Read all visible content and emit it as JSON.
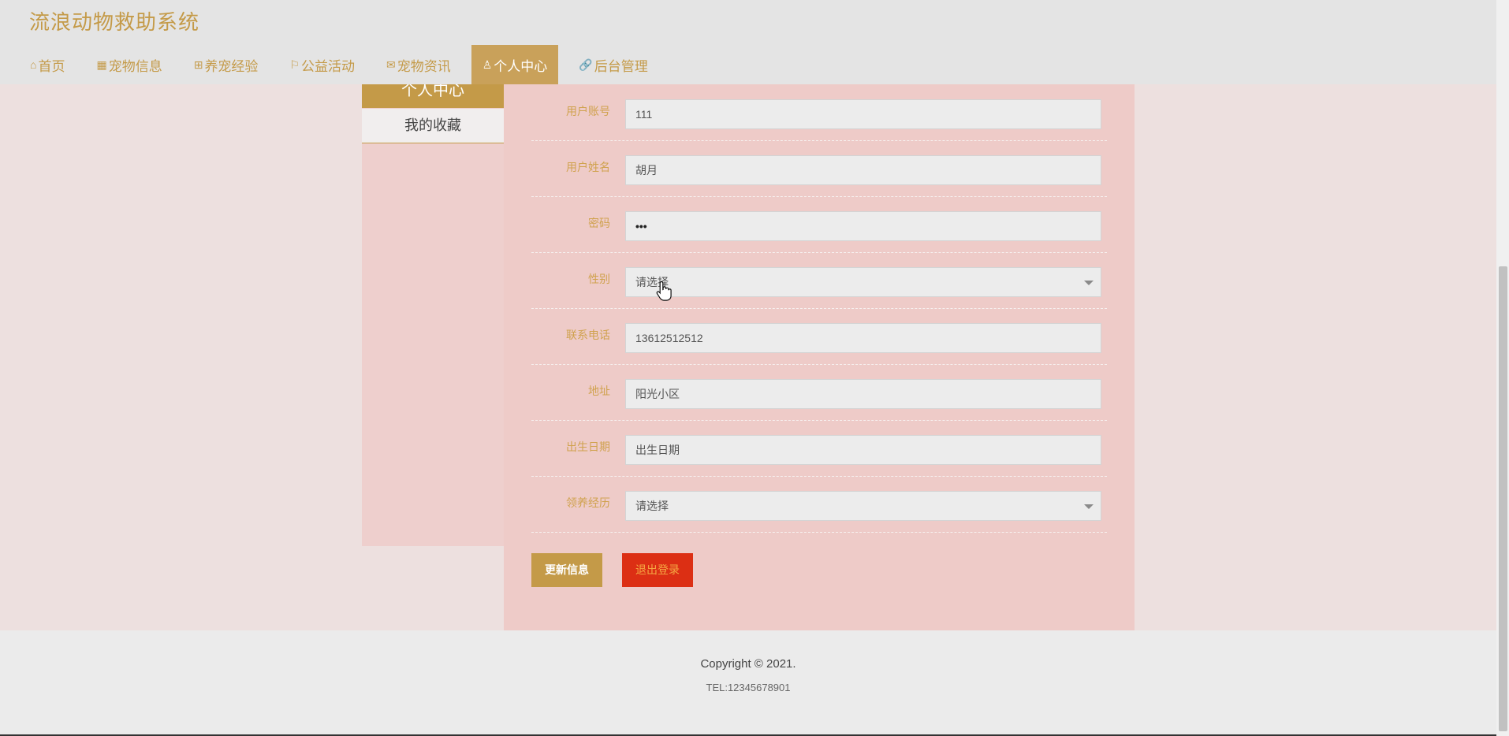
{
  "header": {
    "title": "流浪动物救助系统",
    "nav": [
      {
        "icon": "⌂",
        "label": "首页"
      },
      {
        "icon": "▦",
        "label": "宠物信息"
      },
      {
        "icon": "⊞",
        "label": "养宠经验"
      },
      {
        "icon": "⚐",
        "label": "公益活动"
      },
      {
        "icon": "✉",
        "label": "宠物资讯"
      },
      {
        "icon": "♙",
        "label": "个人中心"
      },
      {
        "icon": "🔗",
        "label": "后台管理"
      }
    ],
    "active_index": 5
  },
  "sidebar": {
    "header": "个人中心",
    "items": [
      {
        "label": "我的收藏"
      }
    ]
  },
  "form": {
    "fields": [
      {
        "label": "用户账号",
        "value": "111",
        "placeholder": ""
      },
      {
        "label": "用户姓名",
        "value": "胡月",
        "placeholder": ""
      },
      {
        "label": "密码",
        "value": "•••",
        "placeholder": ""
      },
      {
        "label": "性别",
        "value": "请选择",
        "placeholder": ""
      },
      {
        "label": "联系电话",
        "value": "13612512512",
        "placeholder": ""
      },
      {
        "label": "地址",
        "value": "阳光小区",
        "placeholder": ""
      },
      {
        "label": "出生日期",
        "value": "",
        "placeholder": "出生日期"
      },
      {
        "label": "领养经历",
        "value": "请选择",
        "placeholder": ""
      }
    ],
    "update_button": "更新信息",
    "logout_button": "退出登录"
  },
  "footer": {
    "copyright": "Copyright © 2021.",
    "tel": "TEL:12345678901"
  },
  "colors": {
    "accent": "#c49a48",
    "header_bg": "#e4e4e4",
    "panel_bg": "#eecbc8",
    "logout_bg": "#dc2f14"
  }
}
